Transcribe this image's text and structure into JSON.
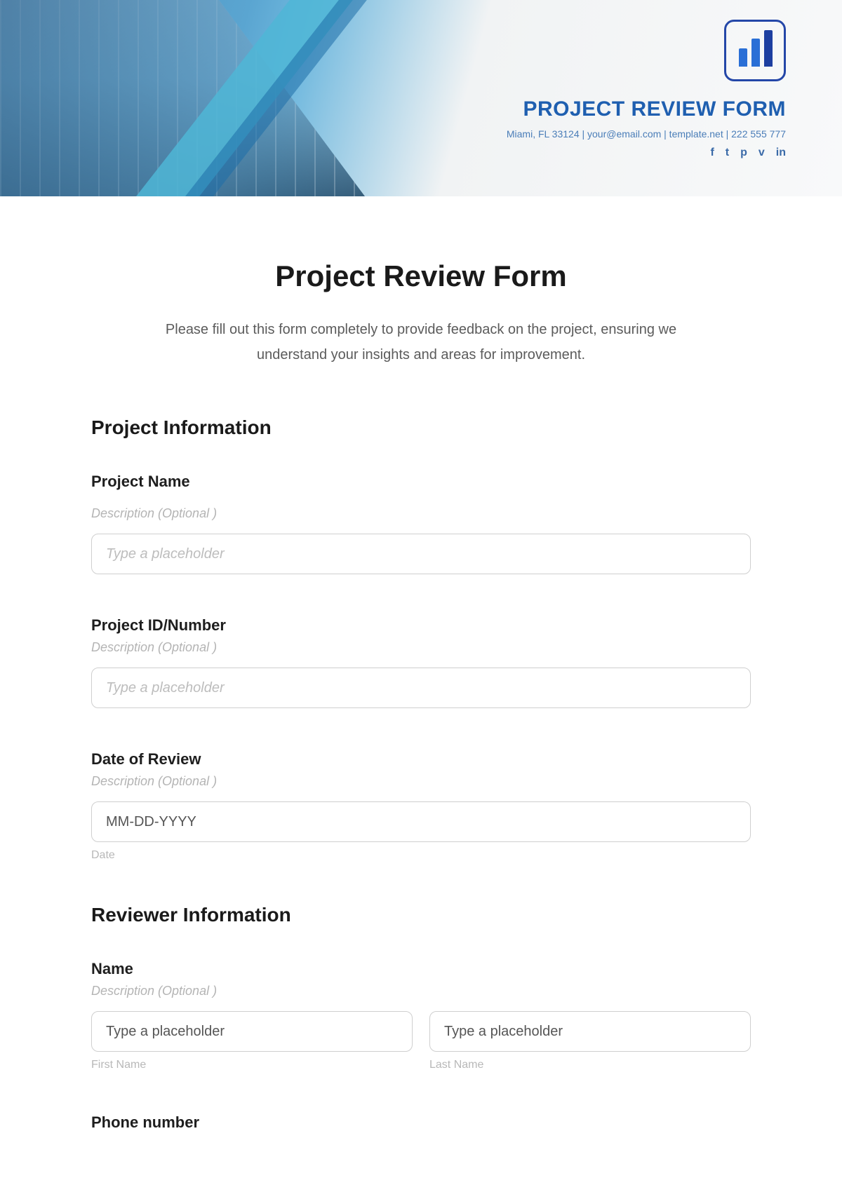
{
  "header": {
    "brand_title": "PROJECT REVIEW FORM",
    "contact_line": "Miami, FL 33124 | your@email.com | template.net | 222 555 777",
    "social": {
      "facebook": "f",
      "tumblr": "t",
      "pinterest": "p",
      "twitter": "v",
      "linkedin": "in"
    }
  },
  "form": {
    "title": "Project Review Form",
    "subtitle": "Please fill out this form completely to provide feedback on the project, ensuring we understand your insights and areas for improvement."
  },
  "sections": {
    "project_info": {
      "title": "Project Information",
      "fields": {
        "project_name": {
          "label": "Project Name",
          "description": "Description (Optional )",
          "placeholder": "Type a placeholder",
          "value": ""
        },
        "project_id": {
          "label": "Project ID/Number",
          "description": "Description (Optional )",
          "placeholder": "Type a placeholder",
          "value": ""
        },
        "date_of_review": {
          "label": "Date of Review",
          "description": "Description (Optional )",
          "placeholder": "MM-DD-YYYY",
          "caption": "Date",
          "value": ""
        }
      }
    },
    "reviewer_info": {
      "title": "Reviewer Information",
      "fields": {
        "name": {
          "label": "Name",
          "description": "Description (Optional )",
          "first_placeholder": "Type a placeholder",
          "last_placeholder": "Type a placeholder",
          "first_caption": "First Name",
          "last_caption": "Last Name",
          "first_value": "",
          "last_value": ""
        },
        "phone": {
          "label": "Phone number"
        }
      }
    }
  }
}
